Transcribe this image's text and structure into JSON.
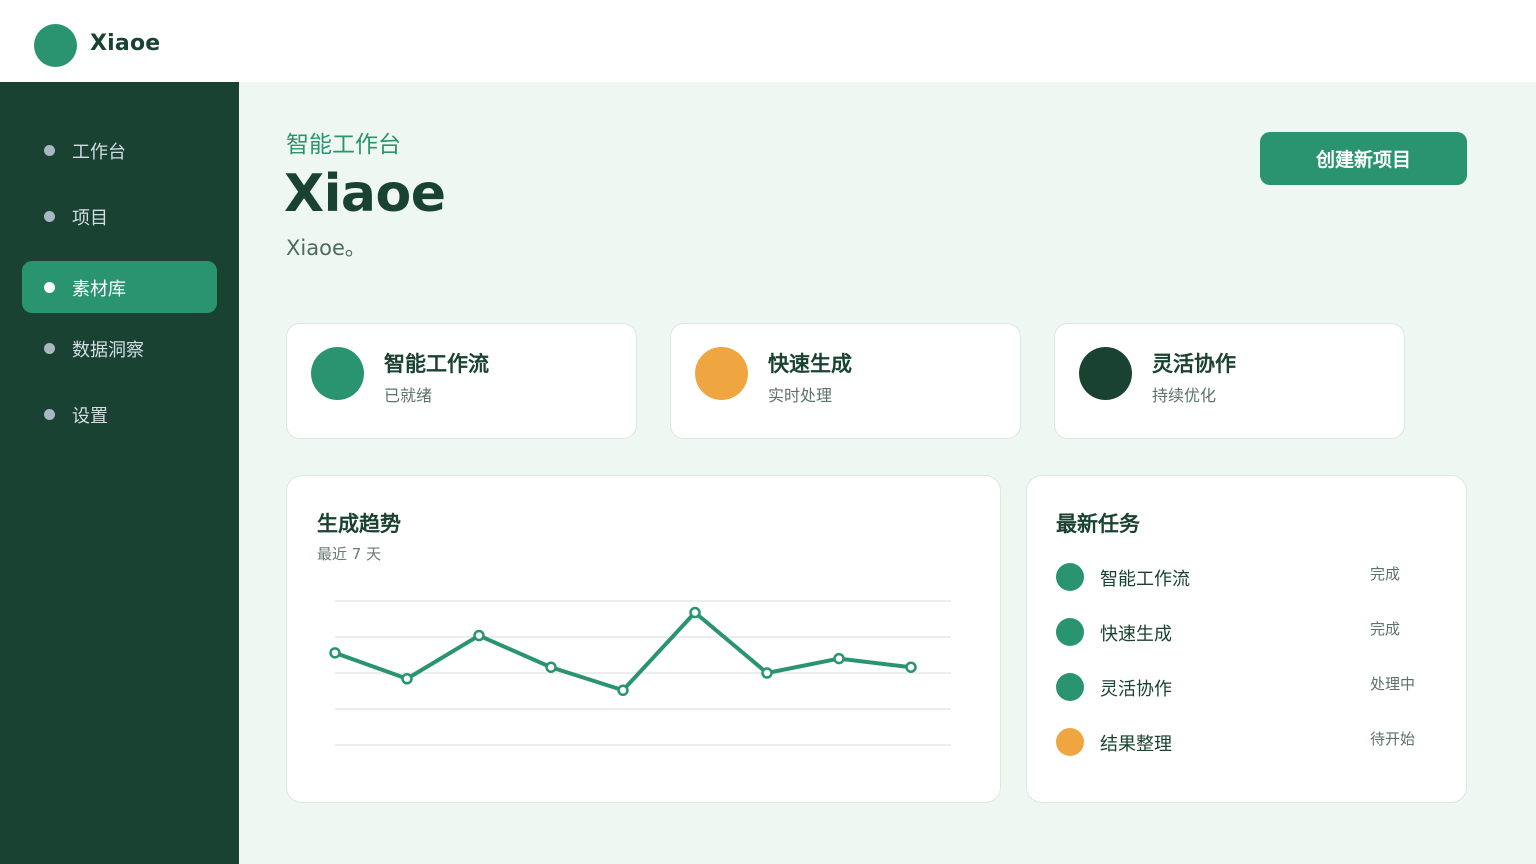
{
  "brand": {
    "name": "Xiaoe",
    "color": "#2a9470"
  },
  "sidebar": {
    "items": [
      {
        "label": "工作台",
        "active": false
      },
      {
        "label": "项目",
        "active": false
      },
      {
        "label": "素材库",
        "active": true
      },
      {
        "label": "数据洞察",
        "active": false
      },
      {
        "label": "设置",
        "active": false
      }
    ]
  },
  "header": {
    "kicker": "智能工作台",
    "title": "Xiaoe",
    "subtitle": "Xiaoe。",
    "primary_button": "创建新项目"
  },
  "stats": [
    {
      "title": "智能工作流",
      "sub": "已就绪",
      "color": "#2a9470"
    },
    {
      "title": "快速生成",
      "sub": "实时处理",
      "color": "#f0a640"
    },
    {
      "title": "灵活协作",
      "sub": "持续优化",
      "color": "#1a4232"
    }
  ],
  "trend": {
    "title": "生成趋势",
    "subtitle": "最近 7 天"
  },
  "chart_data": {
    "type": "line",
    "title": "生成趋势",
    "subtitle": "最近 7 天",
    "x": [
      1,
      2,
      3,
      4,
      5,
      6,
      7,
      8,
      9
    ],
    "values": [
      42,
      33,
      48,
      37,
      29,
      56,
      35,
      40,
      37
    ],
    "ylim": [
      10,
      60
    ],
    "grid": true,
    "color": "#2a9470"
  },
  "tasks": {
    "title": "最新任务",
    "items": [
      {
        "name": "智能工作流",
        "status": "完成",
        "color": "#2a9470"
      },
      {
        "name": "快速生成",
        "status": "完成",
        "color": "#2a9470"
      },
      {
        "name": "灵活协作",
        "status": "处理中",
        "color": "#2a9470"
      },
      {
        "name": "结果整理",
        "status": "待开始",
        "color": "#f0a640"
      }
    ]
  }
}
